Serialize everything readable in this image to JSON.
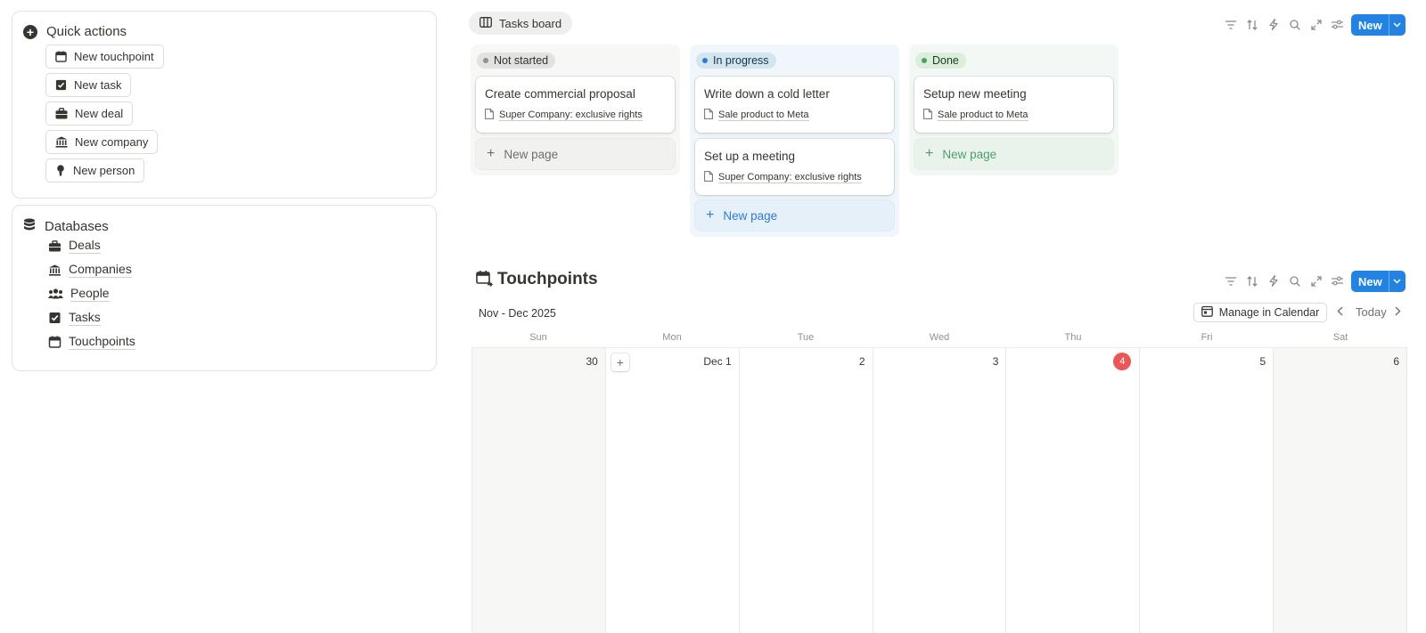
{
  "quick_actions": {
    "title": "Quick actions",
    "buttons": [
      {
        "label": "New touchpoint",
        "icon": "calendar-icon"
      },
      {
        "label": "New task",
        "icon": "checkbox-icon"
      },
      {
        "label": "New deal",
        "icon": "briefcase-icon"
      },
      {
        "label": "New company",
        "icon": "bank-icon"
      },
      {
        "label": "New person",
        "icon": "person-icon"
      }
    ]
  },
  "databases": {
    "title": "Databases",
    "items": [
      {
        "label": "Deals",
        "icon": "briefcase-icon"
      },
      {
        "label": "Companies",
        "icon": "bank-icon"
      },
      {
        "label": "People",
        "icon": "people-icon"
      },
      {
        "label": "Tasks",
        "icon": "checkbox-icon"
      },
      {
        "label": "Touchpoints",
        "icon": "calendar-icon"
      }
    ]
  },
  "board": {
    "view_tab": "Tasks board",
    "new_label": "New",
    "columns": [
      {
        "status": "Not started",
        "cards": [
          {
            "title": "Create commercial proposal",
            "relation": "Super Company: exclusive rights"
          }
        ],
        "new_page": "New page"
      },
      {
        "status": "In progress",
        "cards": [
          {
            "title": "Write down a cold letter",
            "relation": "Sale product to Meta"
          },
          {
            "title": "Set up a meeting",
            "relation": "Super Company: exclusive rights"
          }
        ],
        "new_page": "New page"
      },
      {
        "status": "Done",
        "cards": [
          {
            "title": "Setup new meeting",
            "relation": "Sale product to Meta"
          }
        ],
        "new_page": "New page"
      }
    ]
  },
  "calendar": {
    "title": "Touchpoints",
    "new_label": "New",
    "range": "Nov - Dec 2025",
    "manage_label": "Manage in Calendar",
    "today_label": "Today",
    "weekdays": [
      "Sun",
      "Mon",
      "Tue",
      "Wed",
      "Thu",
      "Fri",
      "Sat"
    ],
    "days": [
      "30",
      "Dec 1",
      "2",
      "3",
      "4",
      "5",
      "6"
    ],
    "today_index": 4
  },
  "colors": {
    "accent": "#2383e2",
    "today": "#eb5757"
  }
}
